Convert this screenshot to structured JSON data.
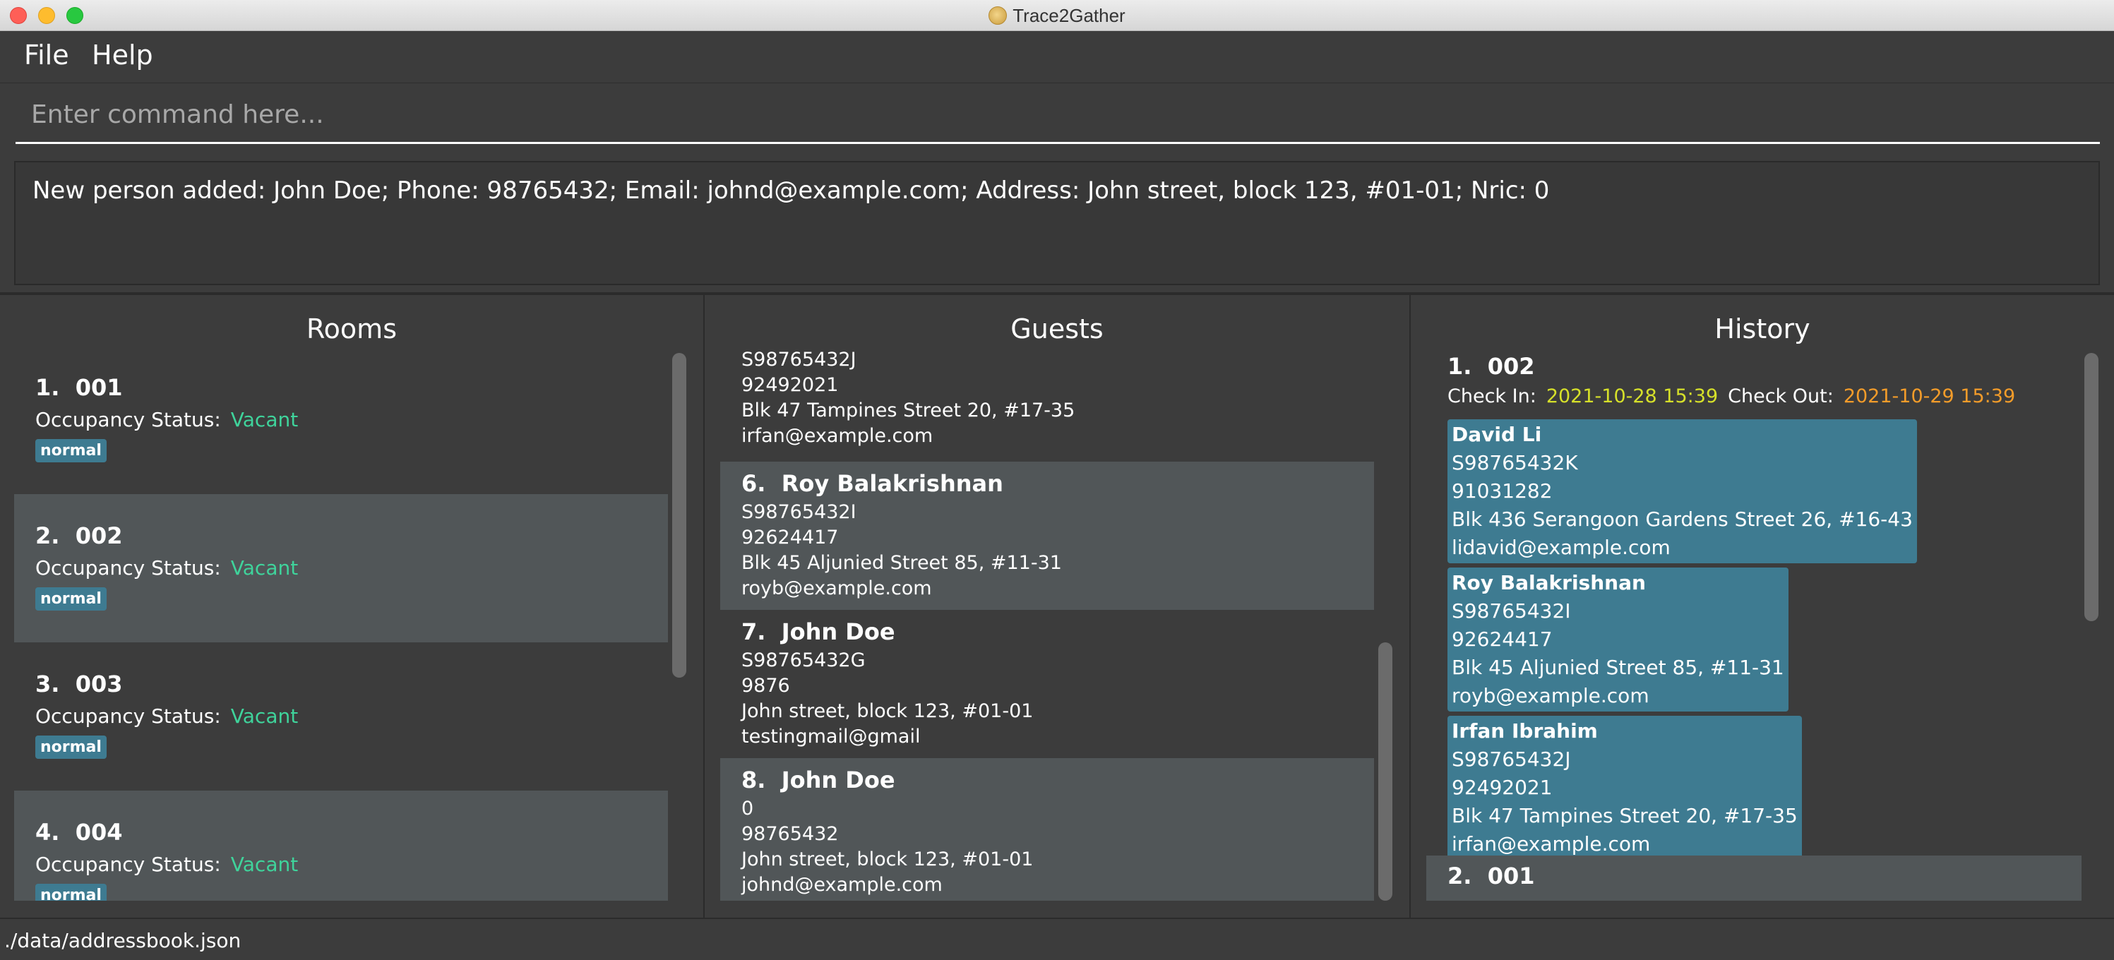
{
  "window": {
    "title": "Trace2Gather",
    "app_icon": "app-icon"
  },
  "menu": {
    "file": "File",
    "help": "Help"
  },
  "command": {
    "placeholder": "Enter command here..."
  },
  "result": {
    "text": "New person added: John Doe; Phone: 98765432; Email: johnd@example.com; Address: John street, block 123, #01-01; Nric: 0"
  },
  "rooms": {
    "title": "Rooms",
    "status_label": "Occupancy Status:",
    "items": [
      {
        "index": "1.",
        "number": "001",
        "status": "Vacant",
        "tag": "normal"
      },
      {
        "index": "2.",
        "number": "002",
        "status": "Vacant",
        "tag": "normal"
      },
      {
        "index": "3.",
        "number": "003",
        "status": "Vacant",
        "tag": "normal"
      },
      {
        "index": "4.",
        "number": "004",
        "status": "Vacant",
        "tag": "normal"
      }
    ]
  },
  "guests": {
    "title": "Guests",
    "partial": {
      "nric": "S98765432J",
      "phone": "92492021",
      "address": "Blk 47 Tampines Street 20, #17-35",
      "email": "irfan@example.com"
    },
    "items": [
      {
        "index": "6.",
        "name": "Roy Balakrishnan",
        "nric": "S98765432I",
        "phone": "92624417",
        "address": "Blk 45 Aljunied Street 85, #11-31",
        "email": "royb@example.com"
      },
      {
        "index": "7.",
        "name": "John Doe",
        "nric": "S98765432G",
        "phone": "9876",
        "address": "John street, block 123, #01-01",
        "email": "testingmail@gmail"
      },
      {
        "index": "8.",
        "name": "John Doe",
        "nric": "0",
        "phone": "98765432",
        "address": "John street, block 123, #01-01",
        "email": "johnd@example.com"
      }
    ]
  },
  "history": {
    "title": "History",
    "entries": [
      {
        "index": "1.",
        "room": "002",
        "check_in_label": "Check In:",
        "check_in": "2021-10-28 15:39",
        "check_out_label": "Check Out:",
        "check_out": "2021-10-29 15:39",
        "guests": [
          {
            "name": "David Li",
            "nric": "S98765432K",
            "phone": "91031282",
            "address": "Blk 436 Serangoon Gardens Street 26, #16-43",
            "email": "lidavid@example.com"
          },
          {
            "name": "Roy Balakrishnan",
            "nric": "S98765432I",
            "phone": "92624417",
            "address": "Blk 45 Aljunied Street 85, #11-31",
            "email": "royb@example.com"
          },
          {
            "name": "Irfan Ibrahim",
            "nric": "S98765432J",
            "phone": "92492021",
            "address": "Blk 47 Tampines Street 20, #17-35",
            "email": "irfan@example.com"
          }
        ]
      },
      {
        "index": "2.",
        "room": "001"
      }
    ]
  },
  "status_bar": {
    "path": "./data/addressbook.json"
  },
  "colors": {
    "accent_tag": "#3e7b91",
    "vacant": "#3fd39b",
    "check_in": "#d6e02a",
    "check_out": "#f39c2a"
  }
}
